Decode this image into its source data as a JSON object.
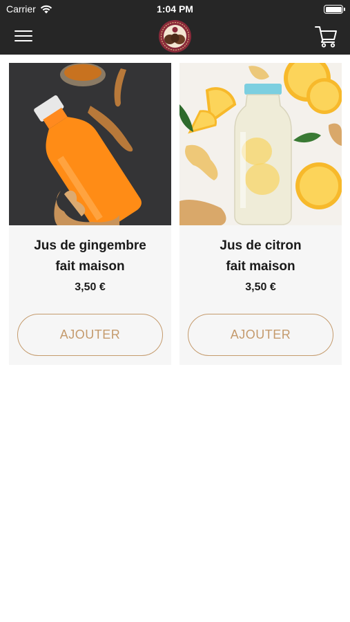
{
  "status_bar": {
    "carrier": "Carrier",
    "time": "1:04 PM"
  },
  "nav": {
    "menu_icon": "hamburger-menu-icon",
    "logo_icon": "brand-logo",
    "cart_icon": "shopping-cart-icon"
  },
  "colors": {
    "bar_background": "#262626",
    "accent": "#c49a6c",
    "card_background": "#f6f6f6"
  },
  "products": [
    {
      "name_line1": "Jus de gingembre",
      "name_line2": "fait maison",
      "price": "3,50 €",
      "button_label": "AJOUTER"
    },
    {
      "name_line1": "Jus de citron",
      "name_line2": "fait maison",
      "price": "3,50 €",
      "button_label": "AJOUTER"
    }
  ]
}
